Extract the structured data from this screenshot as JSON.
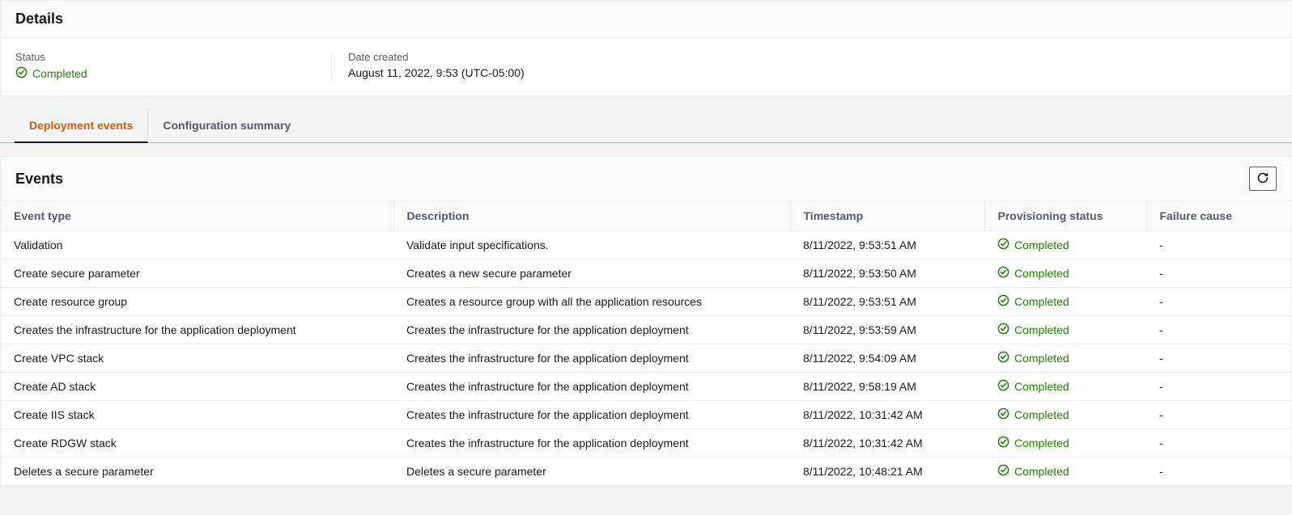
{
  "details": {
    "title": "Details",
    "status_label": "Status",
    "status_value": "Completed",
    "date_label": "Date created",
    "date_value": "August 11, 2022, 9:53 (UTC-05:00)"
  },
  "tabs": {
    "deployment_events": "Deployment events",
    "configuration_summary": "Configuration summary"
  },
  "events": {
    "title": "Events",
    "columns": {
      "event_type": "Event type",
      "description": "Description",
      "timestamp": "Timestamp",
      "provisioning_status": "Provisioning status",
      "failure_cause": "Failure cause"
    },
    "status_text": "Completed",
    "rows": [
      {
        "type": "Validation",
        "desc": "Validate input specifications.",
        "ts": "8/11/2022, 9:53:51 AM",
        "fail": "-"
      },
      {
        "type": "Create secure parameter",
        "desc": "Creates a new secure parameter",
        "ts": "8/11/2022, 9:53:50 AM",
        "fail": "-"
      },
      {
        "type": "Create resource group",
        "desc": "Creates a resource group with all the application resources",
        "ts": "8/11/2022, 9:53:51 AM",
        "fail": "-"
      },
      {
        "type": "Creates the infrastructure for the application deployment",
        "desc": "Creates the infrastructure for the application deployment",
        "ts": "8/11/2022, 9:53:59 AM",
        "fail": "-"
      },
      {
        "type": "Create VPC stack",
        "desc": "Creates the infrastructure for the application deployment",
        "ts": "8/11/2022, 9:54:09 AM",
        "fail": "-"
      },
      {
        "type": "Create AD stack",
        "desc": "Creates the infrastructure for the application deployment",
        "ts": "8/11/2022, 9:58:19 AM",
        "fail": "-"
      },
      {
        "type": "Create IIS stack",
        "desc": "Creates the infrastructure for the application deployment",
        "ts": "8/11/2022, 10:31:42 AM",
        "fail": "-"
      },
      {
        "type": "Create RDGW stack",
        "desc": "Creates the infrastructure for the application deployment",
        "ts": "8/11/2022, 10:31:42 AM",
        "fail": "-"
      },
      {
        "type": "Deletes a secure parameter",
        "desc": "Deletes a secure parameter",
        "ts": "8/11/2022, 10:48:21 AM",
        "fail": "-"
      }
    ]
  }
}
